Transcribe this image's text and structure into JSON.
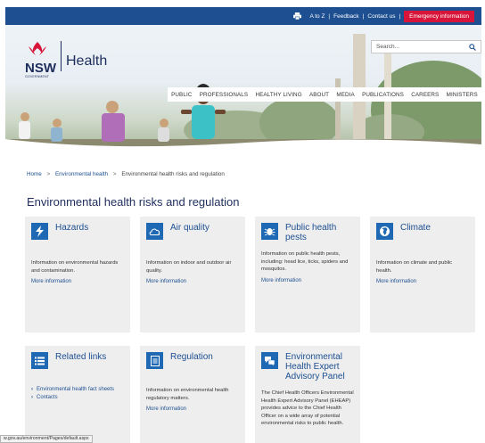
{
  "topbar": {
    "links": [
      "A to Z",
      "|",
      "Feedback",
      "|",
      "Contact us",
      "|"
    ],
    "emergency": "Emergency information",
    "colors": {
      "bar": "#1d4f91",
      "emergency": "#d7153a"
    }
  },
  "logo": {
    "nsw": "NSW",
    "gov": "GOVERNMENT",
    "health": "Health"
  },
  "search": {
    "placeholder": "Search..."
  },
  "nav": [
    "PUBLIC",
    "PROFESSIONALS",
    "HEALTHY LIVING",
    "ABOUT",
    "MEDIA",
    "PUBLICATIONS",
    "CAREERS",
    "MINISTERS"
  ],
  "breadcrumb": {
    "home": "Home",
    "sep": ">",
    "section": "Environmental health",
    "current": "Environmental health risks and regulation"
  },
  "page_title": "Environmental health risks and regulation",
  "tiles": [
    {
      "title": "Hazards",
      "icon": "lightning-icon",
      "desc": "Information on environmental hazards and contamination.",
      "more": "More information"
    },
    {
      "title": "Air quality",
      "icon": "cloud-icon",
      "desc": "Information on indoor and outdoor air quality.",
      "more": "More information"
    },
    {
      "title": "Public health pests",
      "icon": "bug-icon",
      "desc": "Information on public health pests, including: head lice, ticks, spiders and mosquitos.",
      "more": "More information"
    },
    {
      "title": "Climate",
      "icon": "globe-icon",
      "desc": "Information on climate and public health.",
      "more": "More information"
    },
    {
      "title": "Related links",
      "icon": "list-icon",
      "links": [
        "Environmental health fact sheets",
        "Contacts"
      ]
    },
    {
      "title": "Regulation",
      "icon": "document-icon",
      "desc": "Information on environmental health regulatory matters.",
      "more": "More information"
    },
    {
      "title": "Environmental Health Expert Advisory Panel",
      "icon": "chat-icon",
      "desc": "The Chief Health Officers Environmental Health Expert Advisory Panel (EHEAP) provides advice to the Chief Health Officer on a wide array of potential environmental risks to public health."
    }
  ],
  "status_url": "w.gov.au/environment/Pages/default.aspx"
}
